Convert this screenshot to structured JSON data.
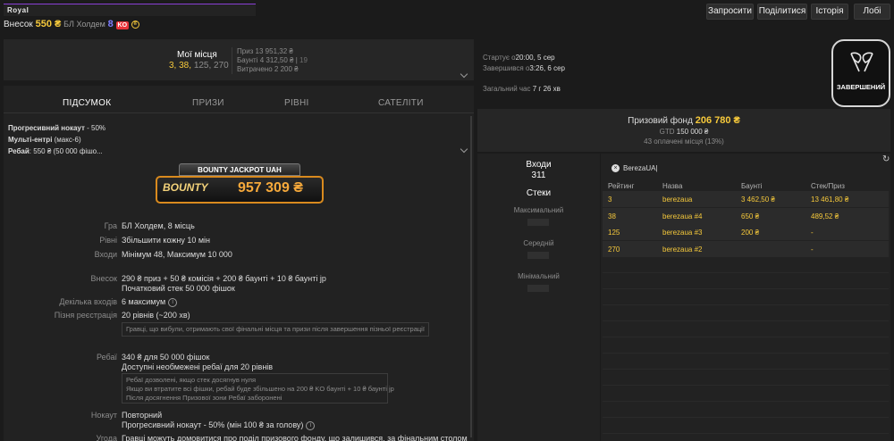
{
  "header": {
    "title": "Royal",
    "buyin_label": "Внесок",
    "buyin_amount": "550 ₴",
    "game": "БЛ Холдем",
    "eight": "8",
    "ko": "KO",
    "coin": "₴"
  },
  "toolbar": {
    "invite": "Запросити",
    "share": "Поділитися",
    "history": "Історія",
    "lobby": "Лобі"
  },
  "places": {
    "title": "Мої місця",
    "p1": "3, 38,",
    "p2": "125, 270",
    "prize": "Приз 13 951,32 ₴",
    "bounty_label": "Баунті 4 312,50 ₴ |",
    "bounty_count": "19",
    "spent": "Витрачено 2 200 ₴"
  },
  "times": {
    "start_label": "Стартує о",
    "start_value": "20:00, 5 сер",
    "end_label": "Завершився о",
    "end_value": "3:26, 6 сер",
    "total_label": "Загальний час",
    "total_value": "7 г 26 хв"
  },
  "status": {
    "label": "ЗАВЕРШЕНИЙ"
  },
  "tabs": [
    "ПІДСУМОК",
    "ПРИЗИ",
    "РІВНІ",
    "САТЕЛІТИ"
  ],
  "summary": {
    "progressive_label": "Прогресивний нокаут",
    "progressive_value": " - 50%",
    "multi_label": "Мульті-ентрі",
    "multi_value": " (макс-6)",
    "rebuy_label": "Ребай",
    "rebuy_value": ": 550 ₴ (50 000 фішо..."
  },
  "jackpot": {
    "title": "BOUNTY JACKPOT UAH",
    "logo": "BOUNTY",
    "amount": "957 309 ₴"
  },
  "details": {
    "game_label": "Гра",
    "game_value": "БЛ Холдем, 8 місць",
    "levels_label": "Рівні",
    "levels_value": "Збільшити кожну 10 мін",
    "entries_label": "Входи",
    "entries_value": "Мінімум 48, Максимум 10 000",
    "buyin_label": "Внесок",
    "buyin_value": "290 ₴ приз + 50 ₴ комісія + 200 ₴ баунті + 10 ₴ баунті jp",
    "buyin_stack": "Початковий стек 50 000 фішок",
    "multi_label": "Декілька входів",
    "multi_value": "6 максимум",
    "late_label": "Пізня реєстрація",
    "late_value": "20 рівнів (~200 хв)",
    "late_note": "Гравці, що вибули, отримають свої фінальні місця та призи після завершення пізньої реєстрації",
    "rebuy_label": "Ребаї",
    "rebuy_value": "340 ₴ для 50 000 фішок",
    "rebuy_value2": "Доступні необмежені ребаї для 20 рівнів",
    "rebuy_note1": "Ребаї дозволені, якщо стек досягнув нуля",
    "rebuy_note2": "Якщо ви втратите всі фішки, ребай буде збільшено на 200 ₴ KO баунті + 10 ₴ баунті jp",
    "rebuy_note3": "Після досягнення Призової зони Ребаї заборонені",
    "knockout_label": "Нокаут",
    "knockout_value": "Повторний",
    "knockout_value2": "Прогресивний нокаут - 50% (мін 100 ₴ за голову)",
    "deal_label": "Угода",
    "deal_value": "Гравці можуть домовитися про поділ призового фонду, що залишився, за фінальним столом"
  },
  "prizepool": {
    "label": "Призовий фонд",
    "value": "206 780 ₴",
    "gtd_label": "GTD",
    "gtd_value": "150 000 ₴",
    "paid": "43 оплачені місця (13%)"
  },
  "entries": {
    "label": "Входи",
    "count": "311",
    "stacks_label": "Стеки",
    "max_label": "Максимальний",
    "avg_label": "Середній",
    "min_label": "Мінімальний"
  },
  "players_table": {
    "filter": "BerezaUA|",
    "columns": [
      "Рейтинг",
      "Назва",
      "Баунті",
      "Стек/Приз"
    ],
    "rows": [
      [
        "3",
        "berezaua",
        "3 462,50 ₴",
        "13 461,80 ₴"
      ],
      [
        "38",
        "berezaua #4",
        "650 ₴",
        "489,52 ₴"
      ],
      [
        "125",
        "berezaua #3",
        "200 ₴",
        "-"
      ],
      [
        "270",
        "berezaua #2",
        "",
        "-"
      ]
    ]
  }
}
